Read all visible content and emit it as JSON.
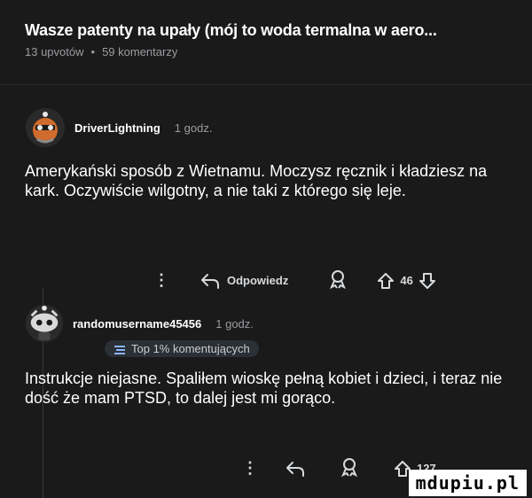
{
  "post": {
    "title": "Wasze patenty na upały (mój to woda termalna w aero...",
    "upvotes": "13 upvotów",
    "separator": "•",
    "comments": "59 komentarzy"
  },
  "comments": [
    {
      "username": "DriverLightning",
      "time": "1 godz.",
      "text": "Amerykański sposób z Wietnamu. Moczysz ręcznik i kładziesz na kark. Oczywiście wilgotny, a nie taki z którego się leje.",
      "reply_label": "Odpowiedz",
      "votes": "46"
    },
    {
      "username": "randomusername45456",
      "time": "1 godz.",
      "badge": "Top 1% komentujących",
      "text": "Instrukcje niejasne. Spaliłem wioskę pełną kobiet i dzieci, i teraz nie dość że mam PTSD, to dalej jest mi gorąco.",
      "votes": "127"
    }
  ],
  "watermark": "mdupiu.pl",
  "icons": [
    "more-icon",
    "reply-icon",
    "award-icon",
    "upvote-icon",
    "downvote-icon"
  ]
}
